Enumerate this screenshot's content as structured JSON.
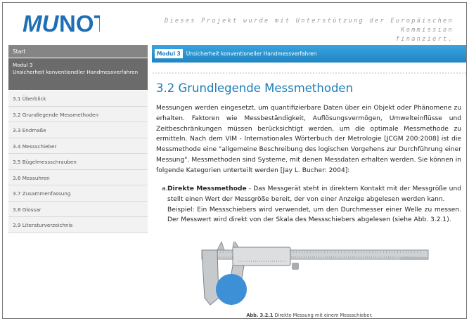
{
  "header": {
    "logo_text": "MUNOT",
    "sponsor_line1": "Dieses Projekt wurde mit Unterstützung der Europäischen Kommission",
    "sponsor_line2": "finanziert."
  },
  "sidebar": {
    "start_label": "Start",
    "module_label": "Modul 3",
    "module_title": "Unsicherheit konventioneller Handmessverfahren",
    "items": [
      {
        "label": "3.1 Überblick"
      },
      {
        "label": "3.2 Grundlegende Messmethoden"
      },
      {
        "label": "3.3 Endmaße"
      },
      {
        "label": "3.4 Messschieber"
      },
      {
        "label": "3.5 Bügelmessschrauben"
      },
      {
        "label": "3.6 Messuhren"
      },
      {
        "label": "3.7 Zusammenfassung"
      },
      {
        "label": "3.8 Glossar"
      },
      {
        "label": "3.9 Literaturverzeichnis"
      }
    ]
  },
  "module_bar": {
    "badge": "Modul 3",
    "title": "Unsicherheit konventioneller Handmessverfahren"
  },
  "main": {
    "heading": "3.2 Grundlegende Messmethoden",
    "paragraph": "Messungen werden eingesetzt, um quantifizierbare Daten über ein Objekt oder Phänomene zu erhalten. Faktoren wie Messbeständigkeit, Auflösungsvermögen, Umwelteinflüsse und Zeitbeschränkungen müssen berücksichtigt werden, um die optimale Messmethode zu ermitteln. Nach dem VIM - Internationales Wörterbuch der Metrologie [JCGM 200:2008] ist die Messmethode eine \"allgemeine Beschreibung des logischen Vorgehens zur Durchführung einer Messung\". Messmethoden sind Systeme, mit denen Messdaten erhalten werden. Sie können in folgende Kategorien unterteilt werden [Jay L. Bucher: 2004]:",
    "method": {
      "marker": "a.",
      "term": "Direkte Messmethode",
      "text": " - Das Messgerät steht in direktem Kontakt mit der Messgröße und stellt einen Wert der Messgröße bereit, der von einer Anzeige abgelesen werden kann.",
      "example": "Beispiel: Ein Messschiebers wird verwendet, um den Durchmesser einer Welle zu messen. Der Messwert wird direkt von der Skala des Messschiebers abgelesen (siehe Abb. 3.2.1)."
    },
    "figure_caption_label": "Abb. 3.2.1",
    "figure_caption_text": " Direkte Messung mit einem Messschieber."
  },
  "colors": {
    "accent_blue": "#1f86c4",
    "heading_blue": "#1a7cb8",
    "logo_blue": "#1f6fb5",
    "sidebar_dark": "#6b6b6b"
  }
}
